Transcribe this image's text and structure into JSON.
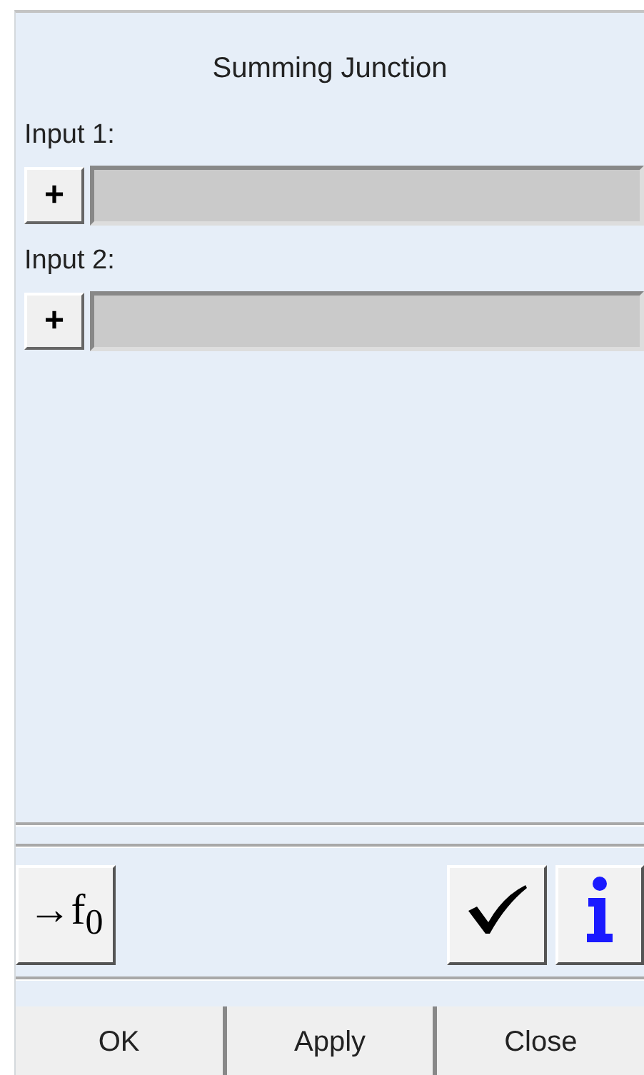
{
  "title": "Summing Junction",
  "inputs": [
    {
      "label": "Input 1:",
      "button": "+"
    },
    {
      "label": "Input 2:",
      "button": "+"
    }
  ],
  "toolbar": {
    "formula_button": "→f$_{0}$"
  },
  "buttons": [
    "OK",
    "Apply",
    "Close"
  ]
}
